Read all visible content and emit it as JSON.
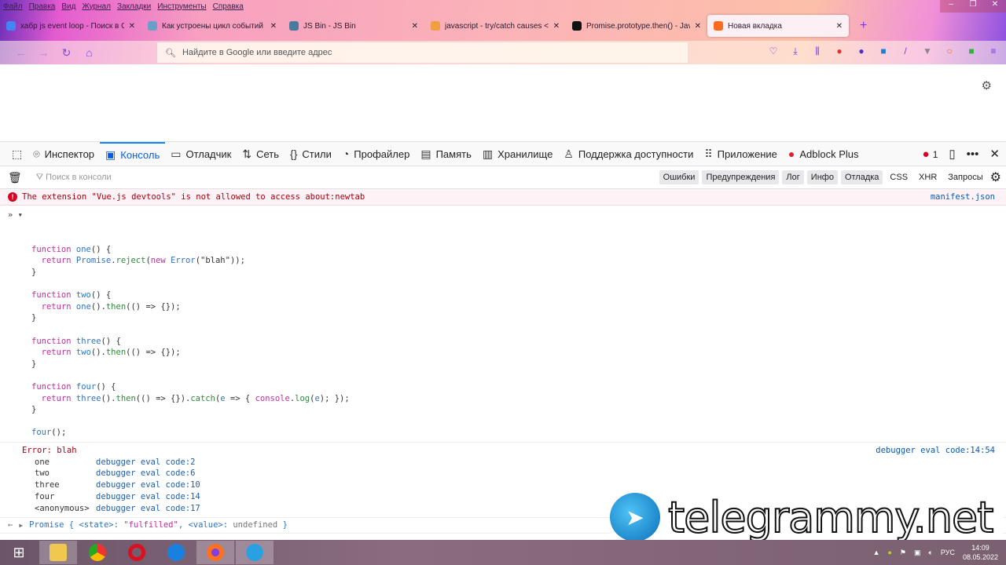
{
  "menu": [
    "Файл",
    "Правка",
    "Вид",
    "Журнал",
    "Закладки",
    "Инструменты",
    "Справка"
  ],
  "tabs": [
    {
      "title": "хабр js event loop - Поиск в Google",
      "color": "#4285f4"
    },
    {
      "title": "Как устроены цикл событий и",
      "color": "#6aa0c8"
    },
    {
      "title": "JS Bin - JS Bin",
      "color": "#4a7aa0"
    },
    {
      "title": "javascript - try/catch causes <а",
      "color": "#f0a040"
    },
    {
      "title": "Promise.prototype.then() - JavaScript",
      "color": "#111111"
    },
    {
      "title": "Новая вкладка",
      "color": "#ff6a20",
      "active": true
    }
  ],
  "url_placeholder": "Найдите в Google или введите адрес",
  "devtools": {
    "tabs": [
      {
        "label": "Инспектор",
        "icon": "inspector-icon",
        "glyph": "⌾"
      },
      {
        "label": "Консоль",
        "icon": "console-icon",
        "glyph": "▣",
        "active": true
      },
      {
        "label": "Отладчик",
        "icon": "debugger-icon",
        "glyph": "▭"
      },
      {
        "label": "Сеть",
        "icon": "network-icon",
        "glyph": "⇅"
      },
      {
        "label": "Стили",
        "icon": "styles-icon",
        "glyph": "{}"
      },
      {
        "label": "Профайлер",
        "icon": "profiler-icon",
        "glyph": "◔"
      },
      {
        "label": "Память",
        "icon": "memory-icon",
        "glyph": "▤"
      },
      {
        "label": "Хранилище",
        "icon": "storage-icon",
        "glyph": "▥"
      },
      {
        "label": "Поддержка доступности",
        "icon": "accessibility-icon",
        "glyph": "♙"
      },
      {
        "label": "Приложение",
        "icon": "application-icon",
        "glyph": "⠿"
      },
      {
        "label": "Adblock Plus",
        "icon": "adblock-icon",
        "glyph": "●"
      }
    ],
    "error_count": "1",
    "filter_placeholder": "Поиск в консоли",
    "filters": [
      "Ошибки",
      "Предупреждения",
      "Лог",
      "Инфо",
      "Отладка"
    ],
    "filters_plain": [
      "CSS",
      "XHR",
      "Запросы"
    ]
  },
  "console": {
    "ext_error": "The extension \"Vue.js devtools\" is not allowed to access about:newtab",
    "ext_error_source": "manifest.json",
    "code": [
      [
        [
          "kw",
          "function "
        ],
        [
          "fn",
          "one"
        ],
        [
          "pl",
          "() {"
        ]
      ],
      [
        [
          "pl",
          "  "
        ],
        [
          "kw",
          "return "
        ],
        [
          "fn",
          "Promise"
        ],
        [
          "pl",
          "."
        ],
        [
          "pm",
          "reject"
        ],
        [
          "pl",
          "("
        ],
        [
          "kw",
          "new "
        ],
        [
          "fn",
          "Error"
        ],
        [
          "pl",
          "(\"blah\"));"
        ]
      ],
      [
        [
          "pl",
          "}"
        ]
      ],
      [
        [
          "pl",
          ""
        ]
      ],
      [
        [
          "kw",
          "function "
        ],
        [
          "fn",
          "two"
        ],
        [
          "pl",
          "() {"
        ]
      ],
      [
        [
          "pl",
          "  "
        ],
        [
          "kw",
          "return "
        ],
        [
          "fn",
          "one"
        ],
        [
          "pl",
          "()."
        ],
        [
          "pm",
          "then"
        ],
        [
          "pl",
          "(() => {});"
        ]
      ],
      [
        [
          "pl",
          "}"
        ]
      ],
      [
        [
          "pl",
          ""
        ]
      ],
      [
        [
          "kw",
          "function "
        ],
        [
          "fn",
          "three"
        ],
        [
          "pl",
          "() {"
        ]
      ],
      [
        [
          "pl",
          "  "
        ],
        [
          "kw",
          "return "
        ],
        [
          "fn",
          "two"
        ],
        [
          "pl",
          "()."
        ],
        [
          "pm",
          "then"
        ],
        [
          "pl",
          "(() => {});"
        ]
      ],
      [
        [
          "pl",
          "}"
        ]
      ],
      [
        [
          "pl",
          ""
        ]
      ],
      [
        [
          "kw",
          "function "
        ],
        [
          "fn",
          "four"
        ],
        [
          "pl",
          "() {"
        ]
      ],
      [
        [
          "pl",
          "  "
        ],
        [
          "kw",
          "return "
        ],
        [
          "fn",
          "three"
        ],
        [
          "pl",
          "()."
        ],
        [
          "pm",
          "then"
        ],
        [
          "pl",
          "(() => {})."
        ],
        [
          "pm",
          "catch"
        ],
        [
          "pl",
          "("
        ],
        [
          "fn",
          "e"
        ],
        [
          "pl",
          " => { "
        ],
        [
          "kw",
          "console"
        ],
        [
          "pl",
          "."
        ],
        [
          "pm",
          "log"
        ],
        [
          "pl",
          "("
        ],
        [
          "fn",
          "e"
        ],
        [
          "pl",
          "); });"
        ]
      ],
      [
        [
          "pl",
          "}"
        ]
      ],
      [
        [
          "pl",
          ""
        ]
      ],
      [
        [
          "fn",
          "four"
        ],
        [
          "pl",
          "();"
        ]
      ]
    ],
    "error_title": "Error: blah",
    "error_source": "debugger eval code:14:54",
    "stack": [
      {
        "name": "one",
        "loc": "debugger eval code:2"
      },
      {
        "name": "two",
        "loc": "debugger eval code:6"
      },
      {
        "name": "three",
        "loc": "debugger eval code:10"
      },
      {
        "name": "four",
        "loc": "debugger eval code:14"
      },
      {
        "name": "<anonymous>",
        "loc": "debugger eval code:17"
      }
    ],
    "result": {
      "prefix": "Promise { <state>: ",
      "state": "\"fulfilled\"",
      "mid": ", <value>: ",
      "value": "undefined",
      "suffix": " }"
    }
  },
  "tray": {
    "lang": "РУС",
    "time": "14:09",
    "date": "08.05.2022"
  },
  "watermark": "telegrammy.net"
}
